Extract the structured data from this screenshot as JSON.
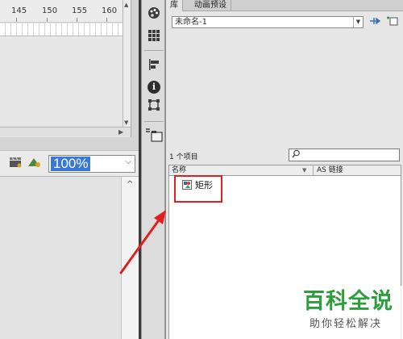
{
  "colors": {
    "accent_selection": "#3a78d8",
    "highlight_box": "#e02020",
    "watermark_green": "#2c9e3c"
  },
  "timeline": {
    "ruler_labels": [
      "145",
      "150",
      "155",
      "160"
    ]
  },
  "stage_toolbar": {
    "zoom_value": "100%",
    "icons": [
      "clapper-icon",
      "symbol-icon"
    ]
  },
  "tool_strip": {
    "icons": [
      "paint-palette-icon",
      "grid-align-icon",
      "align-icon",
      "info-icon",
      "transform-icon",
      "library-icon"
    ]
  },
  "library": {
    "tabs": [
      "库",
      "动画预设"
    ],
    "document_name": "未命名-1",
    "item_count": "1 个项目",
    "search_value": "",
    "columns": {
      "name": "名称",
      "linkage": "AS 链接"
    },
    "items": [
      {
        "label": "矩形",
        "icon": "graphic-symbol-icon"
      }
    ]
  },
  "watermark": {
    "main": "百科全说",
    "sub": "助你轻松解决"
  }
}
